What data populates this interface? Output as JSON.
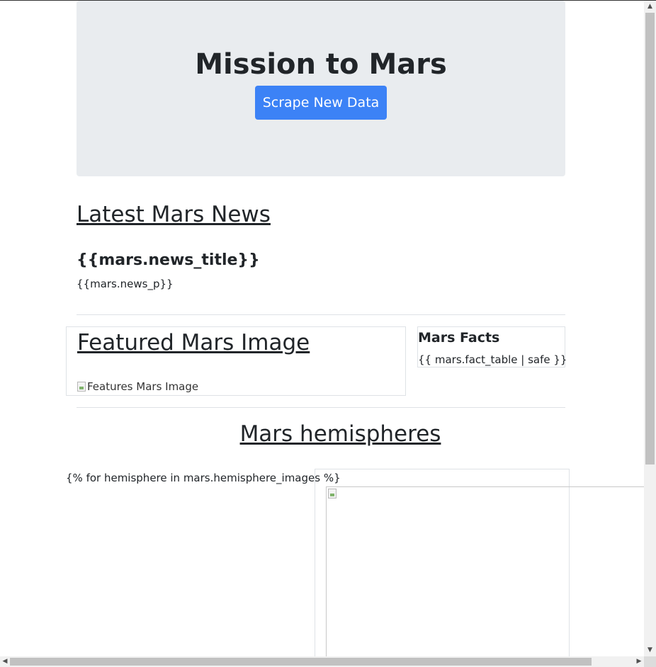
{
  "header": {
    "title": "Mission to Mars",
    "scrape_button_label": "Scrape New Data"
  },
  "news": {
    "heading": "Latest Mars News",
    "title": "{{mars.news_title}}",
    "paragraph": "{{mars.news_p}}"
  },
  "featured": {
    "heading": "Featured Mars Image",
    "image_alt": "Features Mars Image"
  },
  "facts": {
    "heading": "Mars Facts",
    "table_template": "{{ mars.fact_table | safe }}"
  },
  "hemispheres": {
    "heading": "Mars hemispheres",
    "loop_template": "{% for hemisphere in mars.hemisphere_images %}"
  },
  "colors": {
    "jumbotron_bg": "#e9ecef",
    "button_bg": "#3c82f6",
    "text": "#212529"
  },
  "icons": {
    "scroll_up": "arrow-up-icon",
    "scroll_down": "arrow-down-icon",
    "scroll_left": "arrow-left-icon",
    "scroll_right": "arrow-right-icon",
    "broken_image": "broken-image-icon"
  }
}
